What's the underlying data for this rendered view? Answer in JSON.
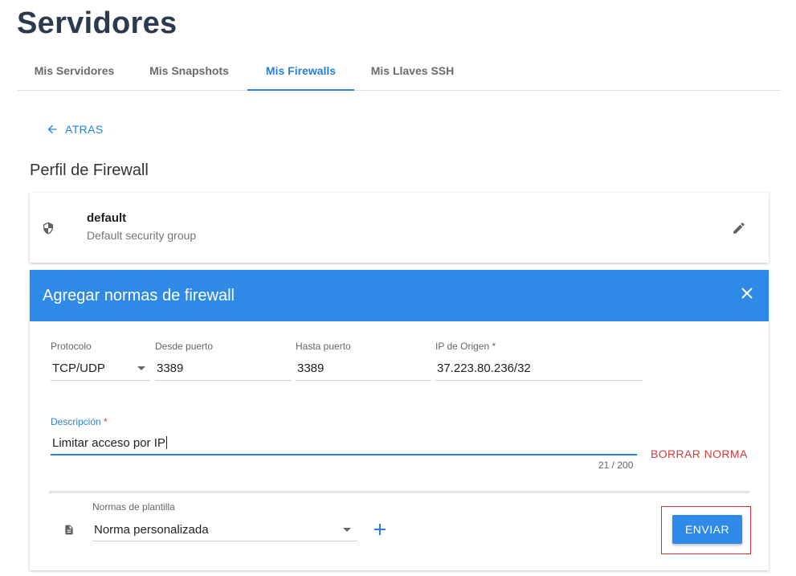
{
  "page": {
    "title": "Servidores"
  },
  "tabs": [
    {
      "label": "Mis Servidores"
    },
    {
      "label": "Mis Snapshots"
    },
    {
      "label": "Mis Firewalls"
    },
    {
      "label": "Mis Llaves SSH"
    }
  ],
  "active_tab": "Mis Firewalls",
  "back": {
    "label": "ATRAS"
  },
  "section": {
    "title": "Perfil de Firewall"
  },
  "profile": {
    "name": "default",
    "description": "Default security group"
  },
  "rules_panel": {
    "title": "Agregar normas de firewall",
    "protocol": {
      "label": "Protocolo",
      "value": "TCP/UDP"
    },
    "from_port": {
      "label": "Desde puerto",
      "value": "3389"
    },
    "to_port": {
      "label": "Hasta puerto",
      "value": "3389"
    },
    "source_ip": {
      "label": "IP de Origen",
      "required_mark": "*",
      "value": "37.223.80.236/32"
    },
    "description": {
      "label": "Descripción",
      "required_mark": "*",
      "value": "Limitar acceso por IP",
      "counter": "21 / 200"
    },
    "delete_rule_label": "BORRAR NORMA",
    "template": {
      "label": "Normas de plantilla",
      "value": "Norma personalizada"
    },
    "send_label": "ENVIAR"
  },
  "colors": {
    "accent": "#2e8ae6",
    "danger": "#d43c3c",
    "title": "#2b3a4f"
  },
  "icons": [
    "arrow-left-icon",
    "shield-icon",
    "pencil-icon",
    "close-icon",
    "dropdown-arrow-icon",
    "document-icon",
    "plus-icon"
  ]
}
